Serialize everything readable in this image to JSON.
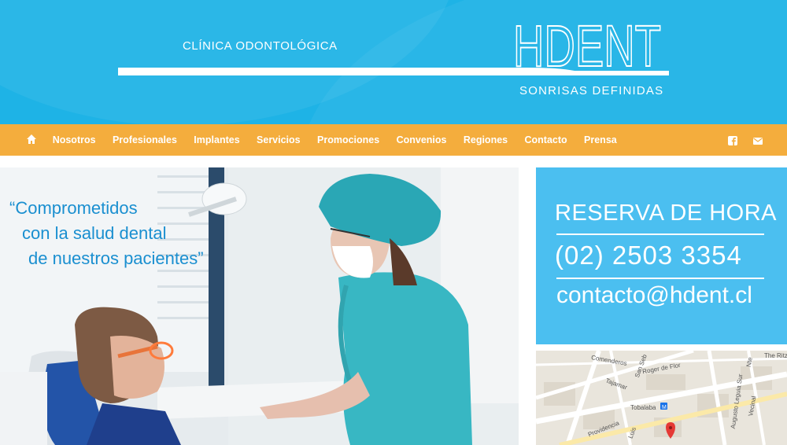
{
  "header": {
    "clinic_label": "CLÍNICA ODONTOLÓGICA",
    "logo": "HDENT",
    "tagline": "SONRISAS DEFINIDAS"
  },
  "nav": {
    "home_icon": "home-icon",
    "items": [
      "Nosotros",
      "Profesionales",
      "Implantes",
      "Servicios",
      "Promociones",
      "Convenios",
      "Regiones",
      "Contacto",
      "Prensa"
    ],
    "social": [
      "facebook-icon",
      "email-icon"
    ]
  },
  "hero": {
    "quote_line1": "“Comprometidos",
    "quote_line2": "con la salud dental",
    "quote_line3": "de nuestros pacientes”"
  },
  "reserva": {
    "title": "RESERVA DE HORA",
    "phone": "(02) 2503 3354",
    "email": "contacto@hdent.cl"
  },
  "map": {
    "labels": [
      "Comenderos",
      "San Seb",
      "Roger de Flor",
      "Tajamar",
      "Tobalaba",
      "Providencia",
      "Luis",
      "Augusto Leguia Sur",
      "Vecinal",
      "The Ritz",
      "Nte"
    ]
  },
  "colors": {
    "header_blue": "#1eb3e6",
    "nav_orange": "#f4ad3d",
    "reserva_blue": "#4bbff0",
    "quote_blue": "#1a8fd0"
  }
}
